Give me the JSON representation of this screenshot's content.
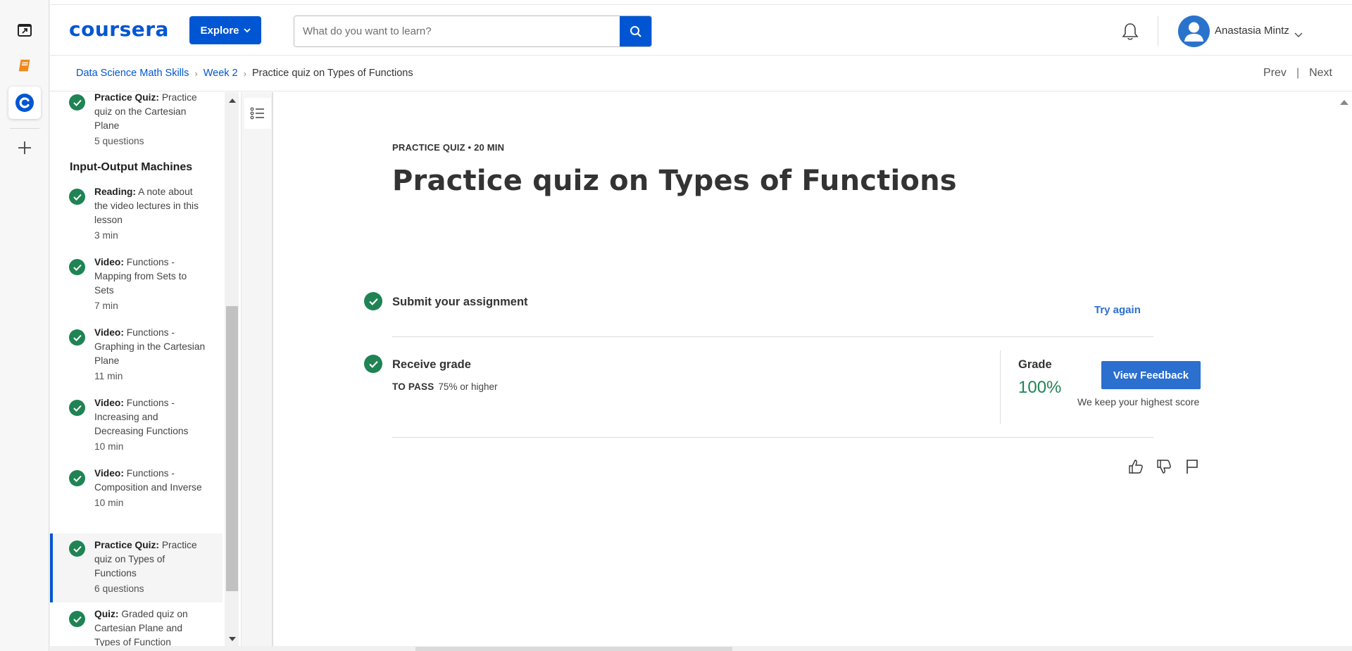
{
  "header": {
    "logo": "coursera",
    "explore_label": "Explore",
    "search_placeholder": "What do you want to learn?",
    "user_name": "Anastasia Mintz"
  },
  "breadcrumb": {
    "items": [
      "Data Science Math Skills",
      "Week 2"
    ],
    "current": "Practice quiz on Types of Functions",
    "prev": "Prev",
    "separator": "|",
    "next": "Next"
  },
  "sidebar": {
    "section_title": "Input-Output Machines",
    "items": [
      {
        "type": "Practice Quiz:",
        "title": "Practice quiz on the Cartesian Plane",
        "meta": "5 questions"
      },
      {
        "type": "Reading:",
        "title": "A note about the video lectures in this lesson",
        "meta": "3 min"
      },
      {
        "type": "Video:",
        "title": "Functions - Mapping from Sets to Sets",
        "meta": "7 min"
      },
      {
        "type": "Video:",
        "title": "Functions - Graphing in the Cartesian Plane",
        "meta": "11 min"
      },
      {
        "type": "Video:",
        "title": "Functions - Increasing and Decreasing Functions",
        "meta": "10 min"
      },
      {
        "type": "Video:",
        "title": "Functions - Composition and Inverse",
        "meta": "10 min"
      },
      {
        "type": "Practice Quiz:",
        "title": "Practice quiz on Types of Functions",
        "meta": "6 questions"
      },
      {
        "type": "Quiz:",
        "title": "Graded quiz on Cartesian Plane and Types of Function",
        "meta": ""
      }
    ]
  },
  "main": {
    "eyebrow": "PRACTICE QUIZ • 20 MIN",
    "title": "Practice quiz on Types of Functions",
    "submit_title": "Submit your assignment",
    "try_again": "Try again",
    "receive_title": "Receive grade",
    "to_pass_label": "TO PASS",
    "to_pass_value": "75% or higher",
    "grade_label": "Grade",
    "grade_value": "100%",
    "view_feedback": "View Feedback",
    "highest_note": "We keep your highest score"
  },
  "colors": {
    "brand": "#0056d2",
    "success": "#1f8354",
    "link": "#2a6fcf"
  }
}
